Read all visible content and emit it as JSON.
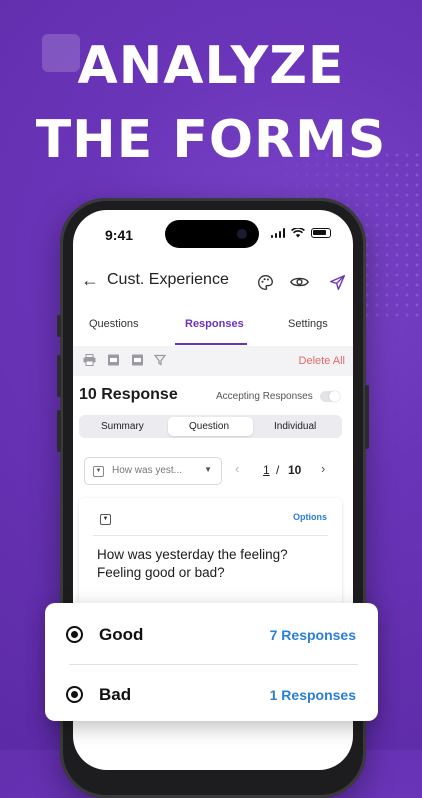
{
  "headline": {
    "line1": "ANALYZE",
    "line2": "THE FORMS"
  },
  "status_bar": {
    "time": "9:41"
  },
  "app_bar": {
    "back_icon": "arrow-left-icon",
    "title": "Cust. Experience",
    "icons": [
      "palette-icon",
      "eye-icon",
      "send-icon"
    ]
  },
  "tabs": [
    {
      "label": "Questions",
      "active": false
    },
    {
      "label": "Responses",
      "active": true
    },
    {
      "label": "Settings",
      "active": false
    }
  ],
  "toolbar": {
    "icons": [
      "print-icon",
      "csv-export-icon",
      "pdf-export-icon",
      "filter-icon"
    ],
    "delete_all": "Delete All"
  },
  "responses": {
    "count_label": "10 Response",
    "accepting_label": "Accepting Responses",
    "accepting_on": false
  },
  "view_segments": [
    {
      "label": "Summary",
      "active": false
    },
    {
      "label": "Question",
      "active": true
    },
    {
      "label": "Individual",
      "active": false
    }
  ],
  "question_select": {
    "value": "How was yest...",
    "icon": "dropdown-question-icon"
  },
  "pager": {
    "current": "1",
    "separator": "/",
    "total": "10"
  },
  "question_card": {
    "options_label": "Options",
    "text": "How was yesterday the feeling? Feeling good or bad?"
  },
  "answers": [
    {
      "label": "Good",
      "count": "7 Responses"
    },
    {
      "label": "Bad",
      "count": "1 Responses"
    }
  ],
  "colors": {
    "brand_purple": "#6a34b8",
    "link_blue": "#2a7fd6",
    "danger_red": "#e06a6a"
  }
}
